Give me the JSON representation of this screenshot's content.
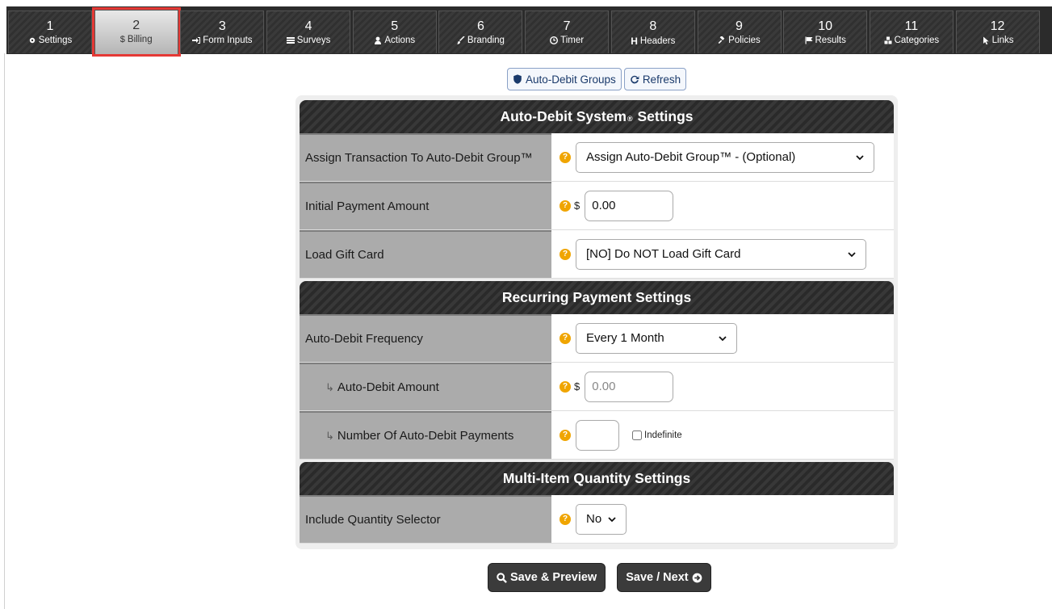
{
  "tabs": [
    {
      "num": "1",
      "label": "Settings",
      "icon": "gear-icon"
    },
    {
      "num": "2",
      "label": "Billing",
      "icon": "dollar-icon"
    },
    {
      "num": "3",
      "label": "Form Inputs",
      "icon": "sign-in-icon"
    },
    {
      "num": "4",
      "label": "Surveys",
      "icon": "list-icon"
    },
    {
      "num": "5",
      "label": "Actions",
      "icon": "user-icon"
    },
    {
      "num": "6",
      "label": "Branding",
      "icon": "brush-icon"
    },
    {
      "num": "7",
      "label": "Timer",
      "icon": "clock-icon"
    },
    {
      "num": "8",
      "label": "Headers",
      "icon": "header-icon"
    },
    {
      "num": "9",
      "label": "Policies",
      "icon": "gavel-icon"
    },
    {
      "num": "10",
      "label": "Results",
      "icon": "flag-icon"
    },
    {
      "num": "11",
      "label": "Categories",
      "icon": "cubes-icon"
    },
    {
      "num": "12",
      "label": "Links",
      "icon": "pointer-icon"
    }
  ],
  "active_tab": "2",
  "toolbar": {
    "auto_debit_groups": "Auto-Debit Groups",
    "refresh": "Refresh"
  },
  "sections": {
    "auto_debit": {
      "title_a": "Auto-Debit System",
      "title_mark": "®",
      "title_b": "Settings",
      "assign_label": "Assign Transaction To Auto-Debit Group™",
      "assign_value": "Assign Auto-Debit Group™ - (Optional)",
      "initial_label": "Initial Payment Amount",
      "initial_value": "0.00",
      "currency": "$",
      "gift_label": "Load Gift Card",
      "gift_value": "[NO] Do NOT Load Gift Card"
    },
    "recurring": {
      "title": "Recurring Payment Settings",
      "freq_label": "Auto-Debit Frequency",
      "freq_value": "Every 1 Month",
      "amount_label": "Auto-Debit Amount",
      "amount_placeholder": "0.00",
      "currency": "$",
      "count_label": "Number Of Auto-Debit Payments",
      "indefinite_label": "Indefinite",
      "arrow": "↳"
    },
    "quantity": {
      "title": "Multi-Item Quantity Settings",
      "qty_label": "Include Quantity Selector",
      "qty_value": "No"
    }
  },
  "help_glyph": "?",
  "actions": {
    "save_preview": "Save & Preview",
    "save_next": "Save / Next"
  },
  "colors": {
    "active_outline": "#e53935",
    "help": "#f0a500",
    "dark": "#2b2b2b"
  }
}
